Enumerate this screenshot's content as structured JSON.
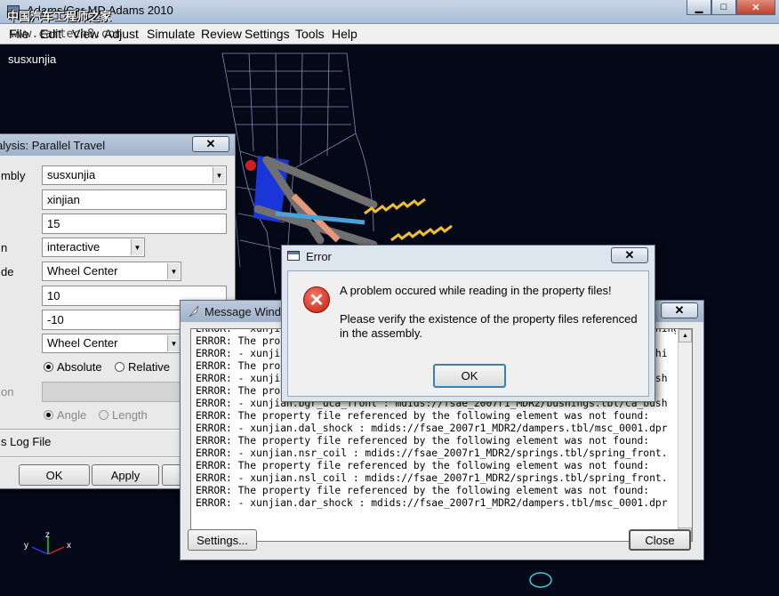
{
  "app": {
    "title": "Adams/Car MD Adams 2010",
    "watermark": "中国汽车工程师之家",
    "watermark_url": "www.cartech8.com",
    "menu": [
      "File",
      "Edit",
      "View",
      "Adjust",
      "Simulate",
      "Review",
      "Settings",
      "Tools",
      "Help"
    ],
    "model_name": "susxunjia",
    "axis_labels": {
      "x": "x",
      "y": "y",
      "z": "z"
    }
  },
  "travel_dialog": {
    "title": "alysis: Parallel Travel",
    "labels": {
      "assembly": "mbly",
      "mode": "n",
      "coordinate": "de",
      "disabled_row": "on"
    },
    "assembly_value": "susxunjia",
    "output_prefix": "xinjian",
    "steps": "15",
    "mode_value": "interactive",
    "coordinate_value": "Wheel Center",
    "bump_travel": "10",
    "rebound_travel": "-10",
    "coordinate2_value": "Wheel Center",
    "radio_absolute": "Absolute",
    "radio_relative": "Relative",
    "radio_angle": "Angle",
    "radio_length": "Length",
    "log_label": "s Log File",
    "ok_label": "OK",
    "apply_label": "Apply"
  },
  "message_window": {
    "title": "Message Wind",
    "lines": [
      "ERROR:   xunjian.bgl_uca_rear : mdids://fsae_2007r1_MDR2/bushings.tbl/ca_bushing.",
      "ERROR: The property file referenced by the following element was not found:",
      "ERROR: - xunjian.bgr_uca_rear : mdids://fsae_2007r1_MDR2/bushings.tbl/ca_bushi",
      "ERROR: The property file referenced by the following element was not found:",
      "ERROR: - xunjian.bgl_lca_front : mdids://fsae_2007r1_MDR2/bushings.tbl/ca_bush",
      "ERROR: The property file referenced by the following element was not found:",
      "ERROR: - xunjian.bgr_uca_front : mdids://fsae_2007r1_MDR2/bushings.tbl/ca_bush",
      "ERROR: The property file referenced by the following element was not found:",
      "ERROR: - xunjian.dal_shock : mdids://fsae_2007r1_MDR2/dampers.tbl/msc_0001.dpr",
      "ERROR: The property file referenced by the following element was not found:",
      "ERROR: - xunjian.nsr_coil : mdids://fsae_2007r1_MDR2/springs.tbl/spring_front.",
      "ERROR: The property file referenced by the following element was not found:",
      "ERROR: - xunjian.nsl_coil : mdids://fsae_2007r1_MDR2/springs.tbl/spring_front.",
      "ERROR: The property file referenced by the following element was not found:",
      "ERROR: - xunjian.dar_shock : mdids://fsae_2007r1_MDR2/dampers.tbl/msc_0001.dpr"
    ],
    "settings_label": "Settings...",
    "close_label": "Close"
  },
  "error_dialog": {
    "title": "Error",
    "message": "A problem occured while reading in the property files!",
    "detail_line1": "Please verify the existence of the property files referenced",
    "detail_line2": "in the assembly.",
    "ok_label": "OK"
  },
  "colors": {
    "viewport_bg": "#050816",
    "dialog_bg": "#e9e9e9",
    "titlebar": "#a9bdd6",
    "error_red": "#c51b0d"
  }
}
